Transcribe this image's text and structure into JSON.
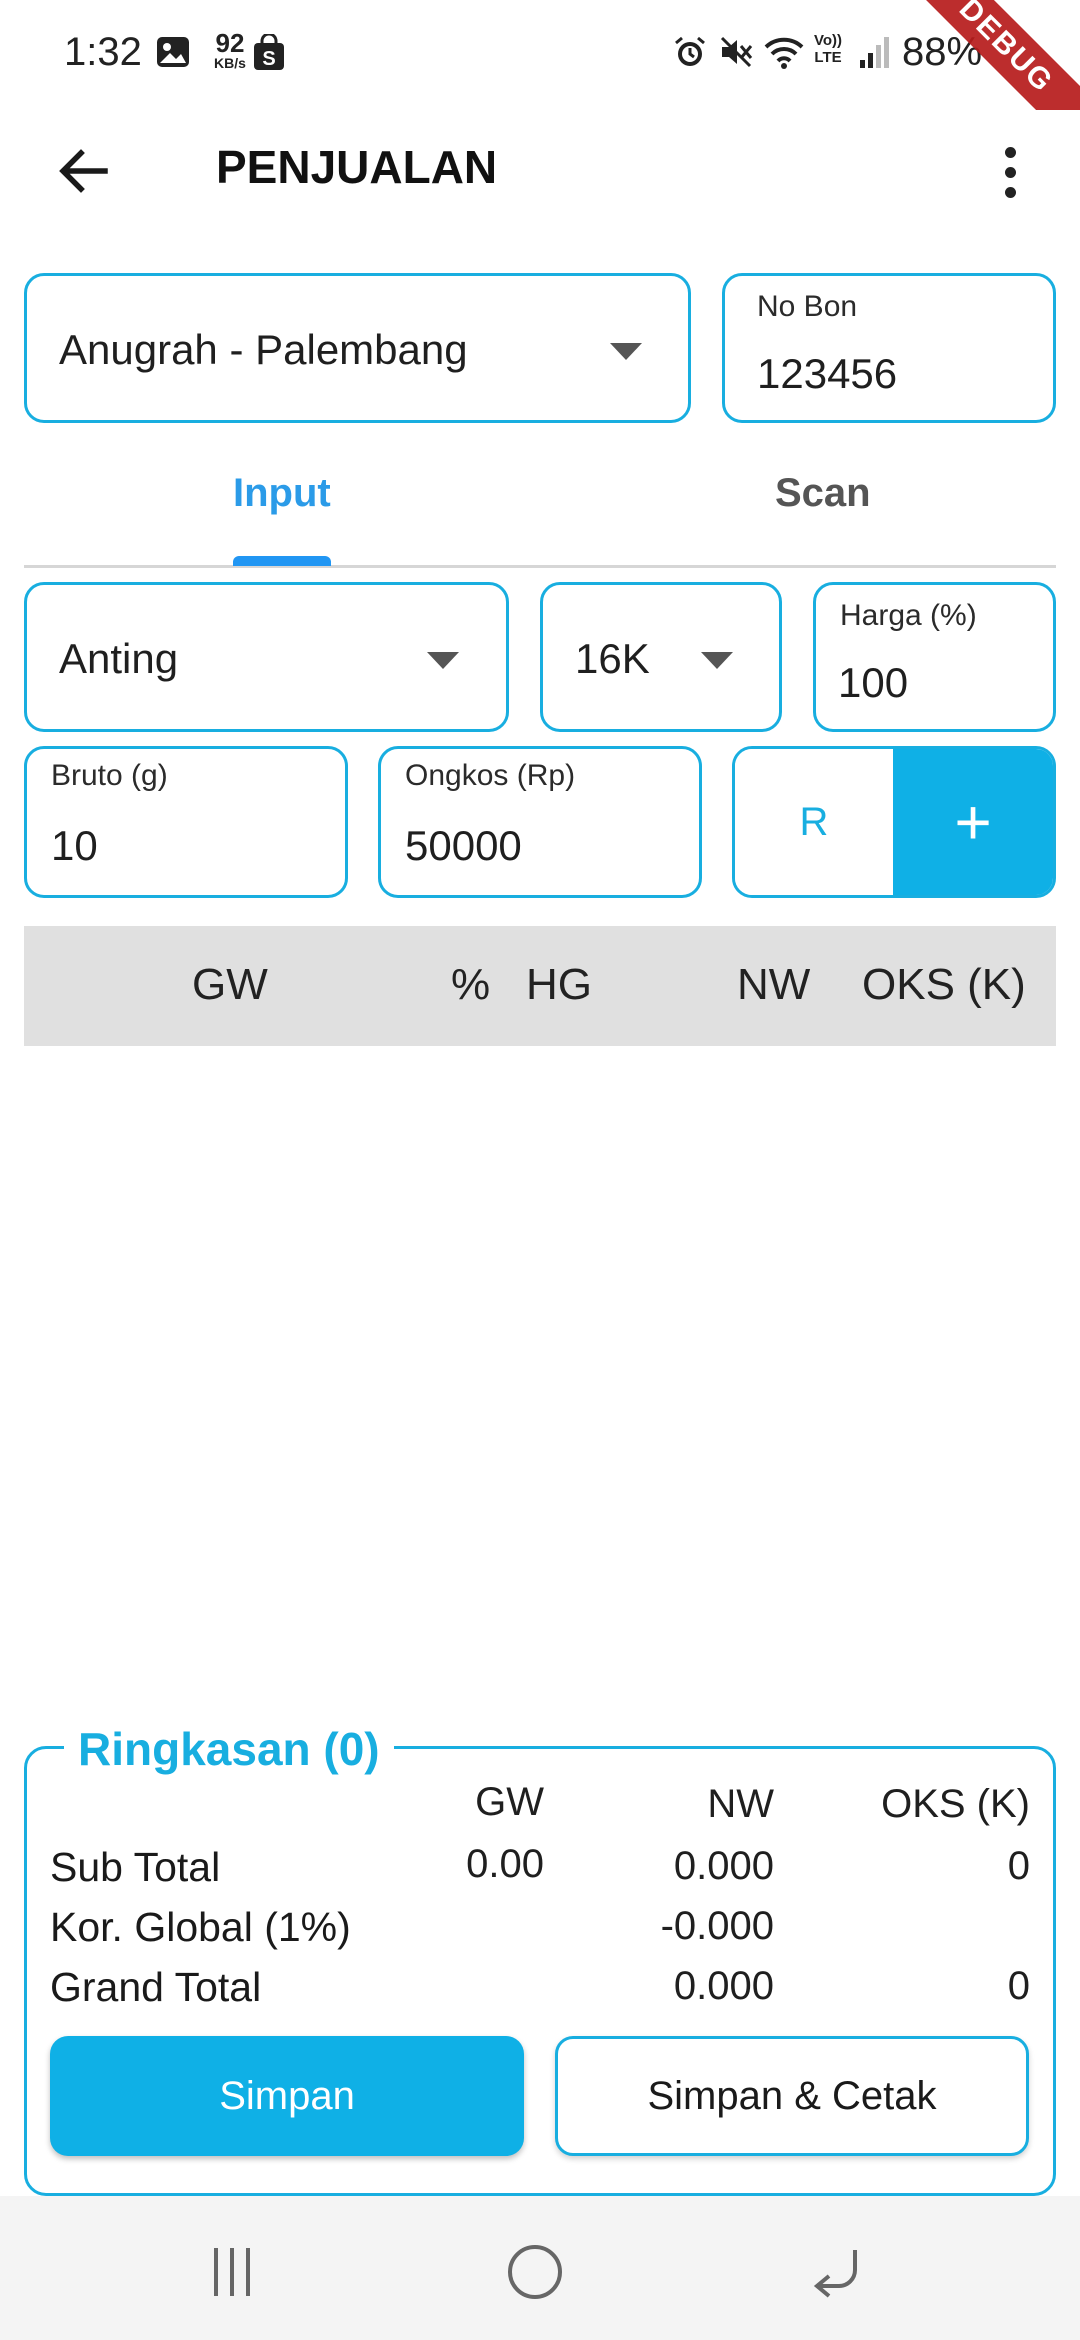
{
  "status_bar": {
    "time": "1:32",
    "net_speed_value": "92",
    "net_speed_unit": "KB/s",
    "battery": "88%",
    "debug_label": "DEBUG"
  },
  "app_bar": {
    "title": "PENJUALAN"
  },
  "store_select": {
    "value": "Anugrah - Palembang"
  },
  "no_bon": {
    "label": "No Bon",
    "value": "123456"
  },
  "tabs": [
    {
      "label": "Input",
      "active": true
    },
    {
      "label": "Scan",
      "active": false
    }
  ],
  "item_type_select": {
    "value": "Anting"
  },
  "karat_select": {
    "value": "16K"
  },
  "harga": {
    "label": "Harga (%)",
    "value": "100"
  },
  "bruto": {
    "label": "Bruto (g)",
    "value": "10"
  },
  "ongkos": {
    "label": "Ongkos (Rp)",
    "value": "50000"
  },
  "actions": {
    "reset_label": "R",
    "add_label": "+"
  },
  "table": {
    "headers": [
      "GW",
      "%",
      "HG",
      "NW",
      "OKS (K)"
    ],
    "rows": []
  },
  "summary": {
    "title": "Ringkasan (0)",
    "columns": [
      "GW",
      "NW",
      "OKS (K)"
    ],
    "rows": [
      {
        "label": "Sub Total",
        "gw": "0.00",
        "nw": "0.000",
        "oks": "0"
      },
      {
        "label": "Kor. Global (1%)",
        "gw": "",
        "nw": "-0.000",
        "oks": ""
      },
      {
        "label": "Grand Total",
        "gw": "",
        "nw": "0.000",
        "oks": "0"
      }
    ],
    "save_label": "Simpan",
    "save_print_label": "Simpan & Cetak"
  },
  "colors": {
    "accent": "#18aee0",
    "tab_active": "#2b9be8",
    "table_header_bg": "#e0e0e0"
  }
}
